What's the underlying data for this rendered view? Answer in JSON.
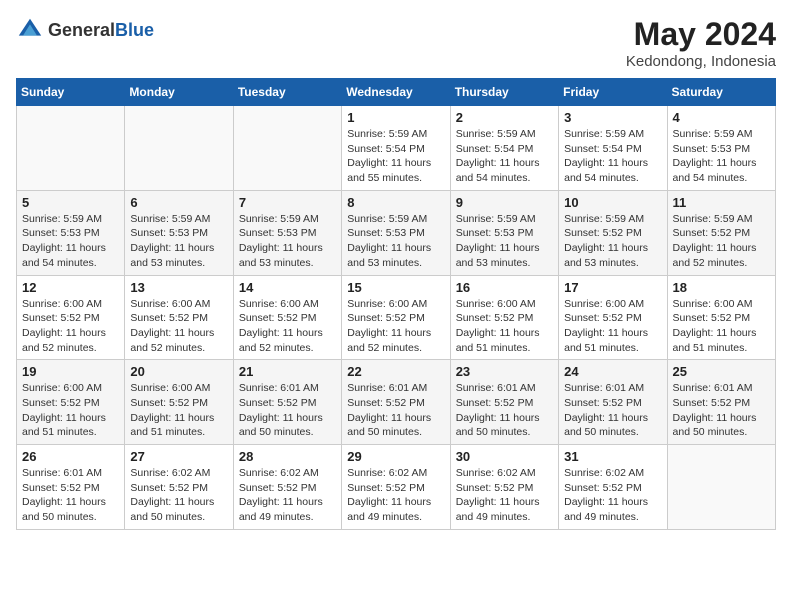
{
  "logo": {
    "general": "General",
    "blue": "Blue"
  },
  "header": {
    "month_year": "May 2024",
    "location": "Kedondong, Indonesia"
  },
  "weekdays": [
    "Sunday",
    "Monday",
    "Tuesday",
    "Wednesday",
    "Thursday",
    "Friday",
    "Saturday"
  ],
  "weeks": [
    [
      {
        "day": "",
        "info": ""
      },
      {
        "day": "",
        "info": ""
      },
      {
        "day": "",
        "info": ""
      },
      {
        "day": "1",
        "info": "Sunrise: 5:59 AM\nSunset: 5:54 PM\nDaylight: 11 hours\nand 55 minutes."
      },
      {
        "day": "2",
        "info": "Sunrise: 5:59 AM\nSunset: 5:54 PM\nDaylight: 11 hours\nand 54 minutes."
      },
      {
        "day": "3",
        "info": "Sunrise: 5:59 AM\nSunset: 5:54 PM\nDaylight: 11 hours\nand 54 minutes."
      },
      {
        "day": "4",
        "info": "Sunrise: 5:59 AM\nSunset: 5:53 PM\nDaylight: 11 hours\nand 54 minutes."
      }
    ],
    [
      {
        "day": "5",
        "info": "Sunrise: 5:59 AM\nSunset: 5:53 PM\nDaylight: 11 hours\nand 54 minutes."
      },
      {
        "day": "6",
        "info": "Sunrise: 5:59 AM\nSunset: 5:53 PM\nDaylight: 11 hours\nand 53 minutes."
      },
      {
        "day": "7",
        "info": "Sunrise: 5:59 AM\nSunset: 5:53 PM\nDaylight: 11 hours\nand 53 minutes."
      },
      {
        "day": "8",
        "info": "Sunrise: 5:59 AM\nSunset: 5:53 PM\nDaylight: 11 hours\nand 53 minutes."
      },
      {
        "day": "9",
        "info": "Sunrise: 5:59 AM\nSunset: 5:53 PM\nDaylight: 11 hours\nand 53 minutes."
      },
      {
        "day": "10",
        "info": "Sunrise: 5:59 AM\nSunset: 5:52 PM\nDaylight: 11 hours\nand 53 minutes."
      },
      {
        "day": "11",
        "info": "Sunrise: 5:59 AM\nSunset: 5:52 PM\nDaylight: 11 hours\nand 52 minutes."
      }
    ],
    [
      {
        "day": "12",
        "info": "Sunrise: 6:00 AM\nSunset: 5:52 PM\nDaylight: 11 hours\nand 52 minutes."
      },
      {
        "day": "13",
        "info": "Sunrise: 6:00 AM\nSunset: 5:52 PM\nDaylight: 11 hours\nand 52 minutes."
      },
      {
        "day": "14",
        "info": "Sunrise: 6:00 AM\nSunset: 5:52 PM\nDaylight: 11 hours\nand 52 minutes."
      },
      {
        "day": "15",
        "info": "Sunrise: 6:00 AM\nSunset: 5:52 PM\nDaylight: 11 hours\nand 52 minutes."
      },
      {
        "day": "16",
        "info": "Sunrise: 6:00 AM\nSunset: 5:52 PM\nDaylight: 11 hours\nand 51 minutes."
      },
      {
        "day": "17",
        "info": "Sunrise: 6:00 AM\nSunset: 5:52 PM\nDaylight: 11 hours\nand 51 minutes."
      },
      {
        "day": "18",
        "info": "Sunrise: 6:00 AM\nSunset: 5:52 PM\nDaylight: 11 hours\nand 51 minutes."
      }
    ],
    [
      {
        "day": "19",
        "info": "Sunrise: 6:00 AM\nSunset: 5:52 PM\nDaylight: 11 hours\nand 51 minutes."
      },
      {
        "day": "20",
        "info": "Sunrise: 6:00 AM\nSunset: 5:52 PM\nDaylight: 11 hours\nand 51 minutes."
      },
      {
        "day": "21",
        "info": "Sunrise: 6:01 AM\nSunset: 5:52 PM\nDaylight: 11 hours\nand 50 minutes."
      },
      {
        "day": "22",
        "info": "Sunrise: 6:01 AM\nSunset: 5:52 PM\nDaylight: 11 hours\nand 50 minutes."
      },
      {
        "day": "23",
        "info": "Sunrise: 6:01 AM\nSunset: 5:52 PM\nDaylight: 11 hours\nand 50 minutes."
      },
      {
        "day": "24",
        "info": "Sunrise: 6:01 AM\nSunset: 5:52 PM\nDaylight: 11 hours\nand 50 minutes."
      },
      {
        "day": "25",
        "info": "Sunrise: 6:01 AM\nSunset: 5:52 PM\nDaylight: 11 hours\nand 50 minutes."
      }
    ],
    [
      {
        "day": "26",
        "info": "Sunrise: 6:01 AM\nSunset: 5:52 PM\nDaylight: 11 hours\nand 50 minutes."
      },
      {
        "day": "27",
        "info": "Sunrise: 6:02 AM\nSunset: 5:52 PM\nDaylight: 11 hours\nand 50 minutes."
      },
      {
        "day": "28",
        "info": "Sunrise: 6:02 AM\nSunset: 5:52 PM\nDaylight: 11 hours\nand 49 minutes."
      },
      {
        "day": "29",
        "info": "Sunrise: 6:02 AM\nSunset: 5:52 PM\nDaylight: 11 hours\nand 49 minutes."
      },
      {
        "day": "30",
        "info": "Sunrise: 6:02 AM\nSunset: 5:52 PM\nDaylight: 11 hours\nand 49 minutes."
      },
      {
        "day": "31",
        "info": "Sunrise: 6:02 AM\nSunset: 5:52 PM\nDaylight: 11 hours\nand 49 minutes."
      },
      {
        "day": "",
        "info": ""
      }
    ]
  ]
}
